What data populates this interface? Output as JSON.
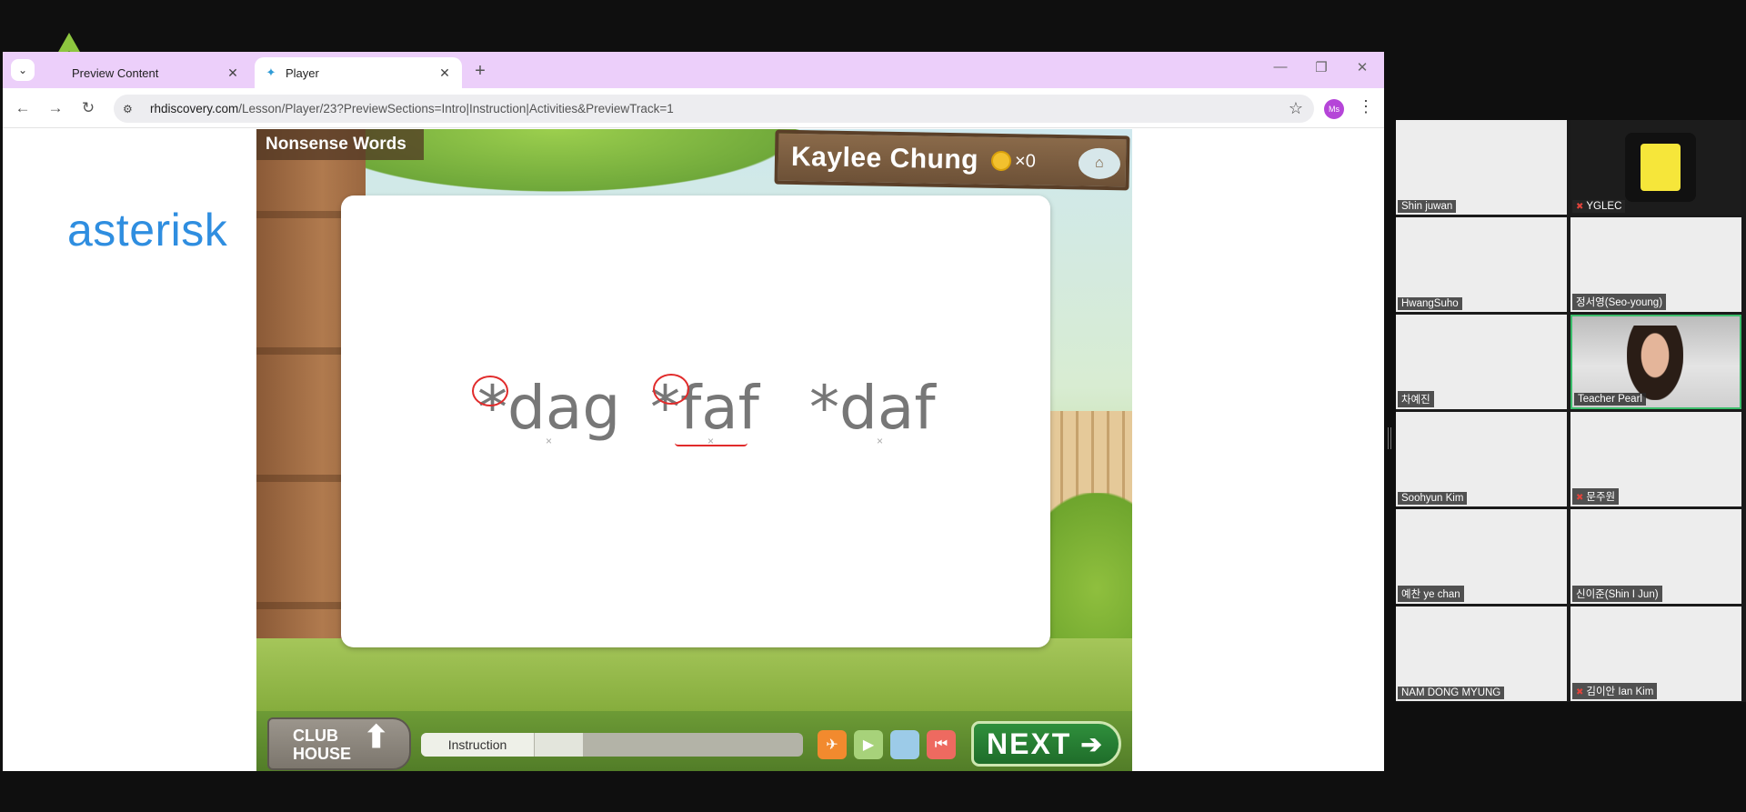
{
  "browser": {
    "tabs": [
      {
        "title": "Preview Content",
        "active": false
      },
      {
        "title": "Player",
        "active": true
      }
    ],
    "url_host": "rhdiscovery.com",
    "url_path": "/Lesson/Player/23?PreviewSections=Intro|Instruction|Activities&PreviewTrack=1",
    "profile_initials": "Ms"
  },
  "slide": {
    "word": "asterisk"
  },
  "game": {
    "section_title": "Nonsense Words",
    "player_name": "Kaylee Chung",
    "coin_count": "×0",
    "words": [
      "*dag",
      "*faf",
      "*daf"
    ],
    "word_marker": "×",
    "clubhouse_label_1": "CLUB",
    "clubhouse_label_2": "HOUSE",
    "progress_section": "Instruction",
    "next_label": "NEXT",
    "colors": {
      "annotation": "#e12b2b",
      "word": "#777777",
      "next": "#2f8f3c"
    }
  },
  "participants": [
    {
      "name": "Shin juwan",
      "muted": false
    },
    {
      "name": "YGLEC",
      "muted": true
    },
    {
      "name": "HwangSuho",
      "muted": false
    },
    {
      "name": "정서영(Seo-young)",
      "muted": false
    },
    {
      "name": "차예진",
      "muted": false
    },
    {
      "name": "Teacher Pearl",
      "muted": false
    },
    {
      "name": "Soohyun Kim",
      "muted": false
    },
    {
      "name": "문주원",
      "muted": true
    },
    {
      "name": "예찬 ye chan",
      "muted": false
    },
    {
      "name": "신이준(Shin I Jun)",
      "muted": false
    },
    {
      "name": "NAM DONG MYUNG",
      "muted": false
    },
    {
      "name": "김이안 Ian Kim",
      "muted": true
    }
  ]
}
